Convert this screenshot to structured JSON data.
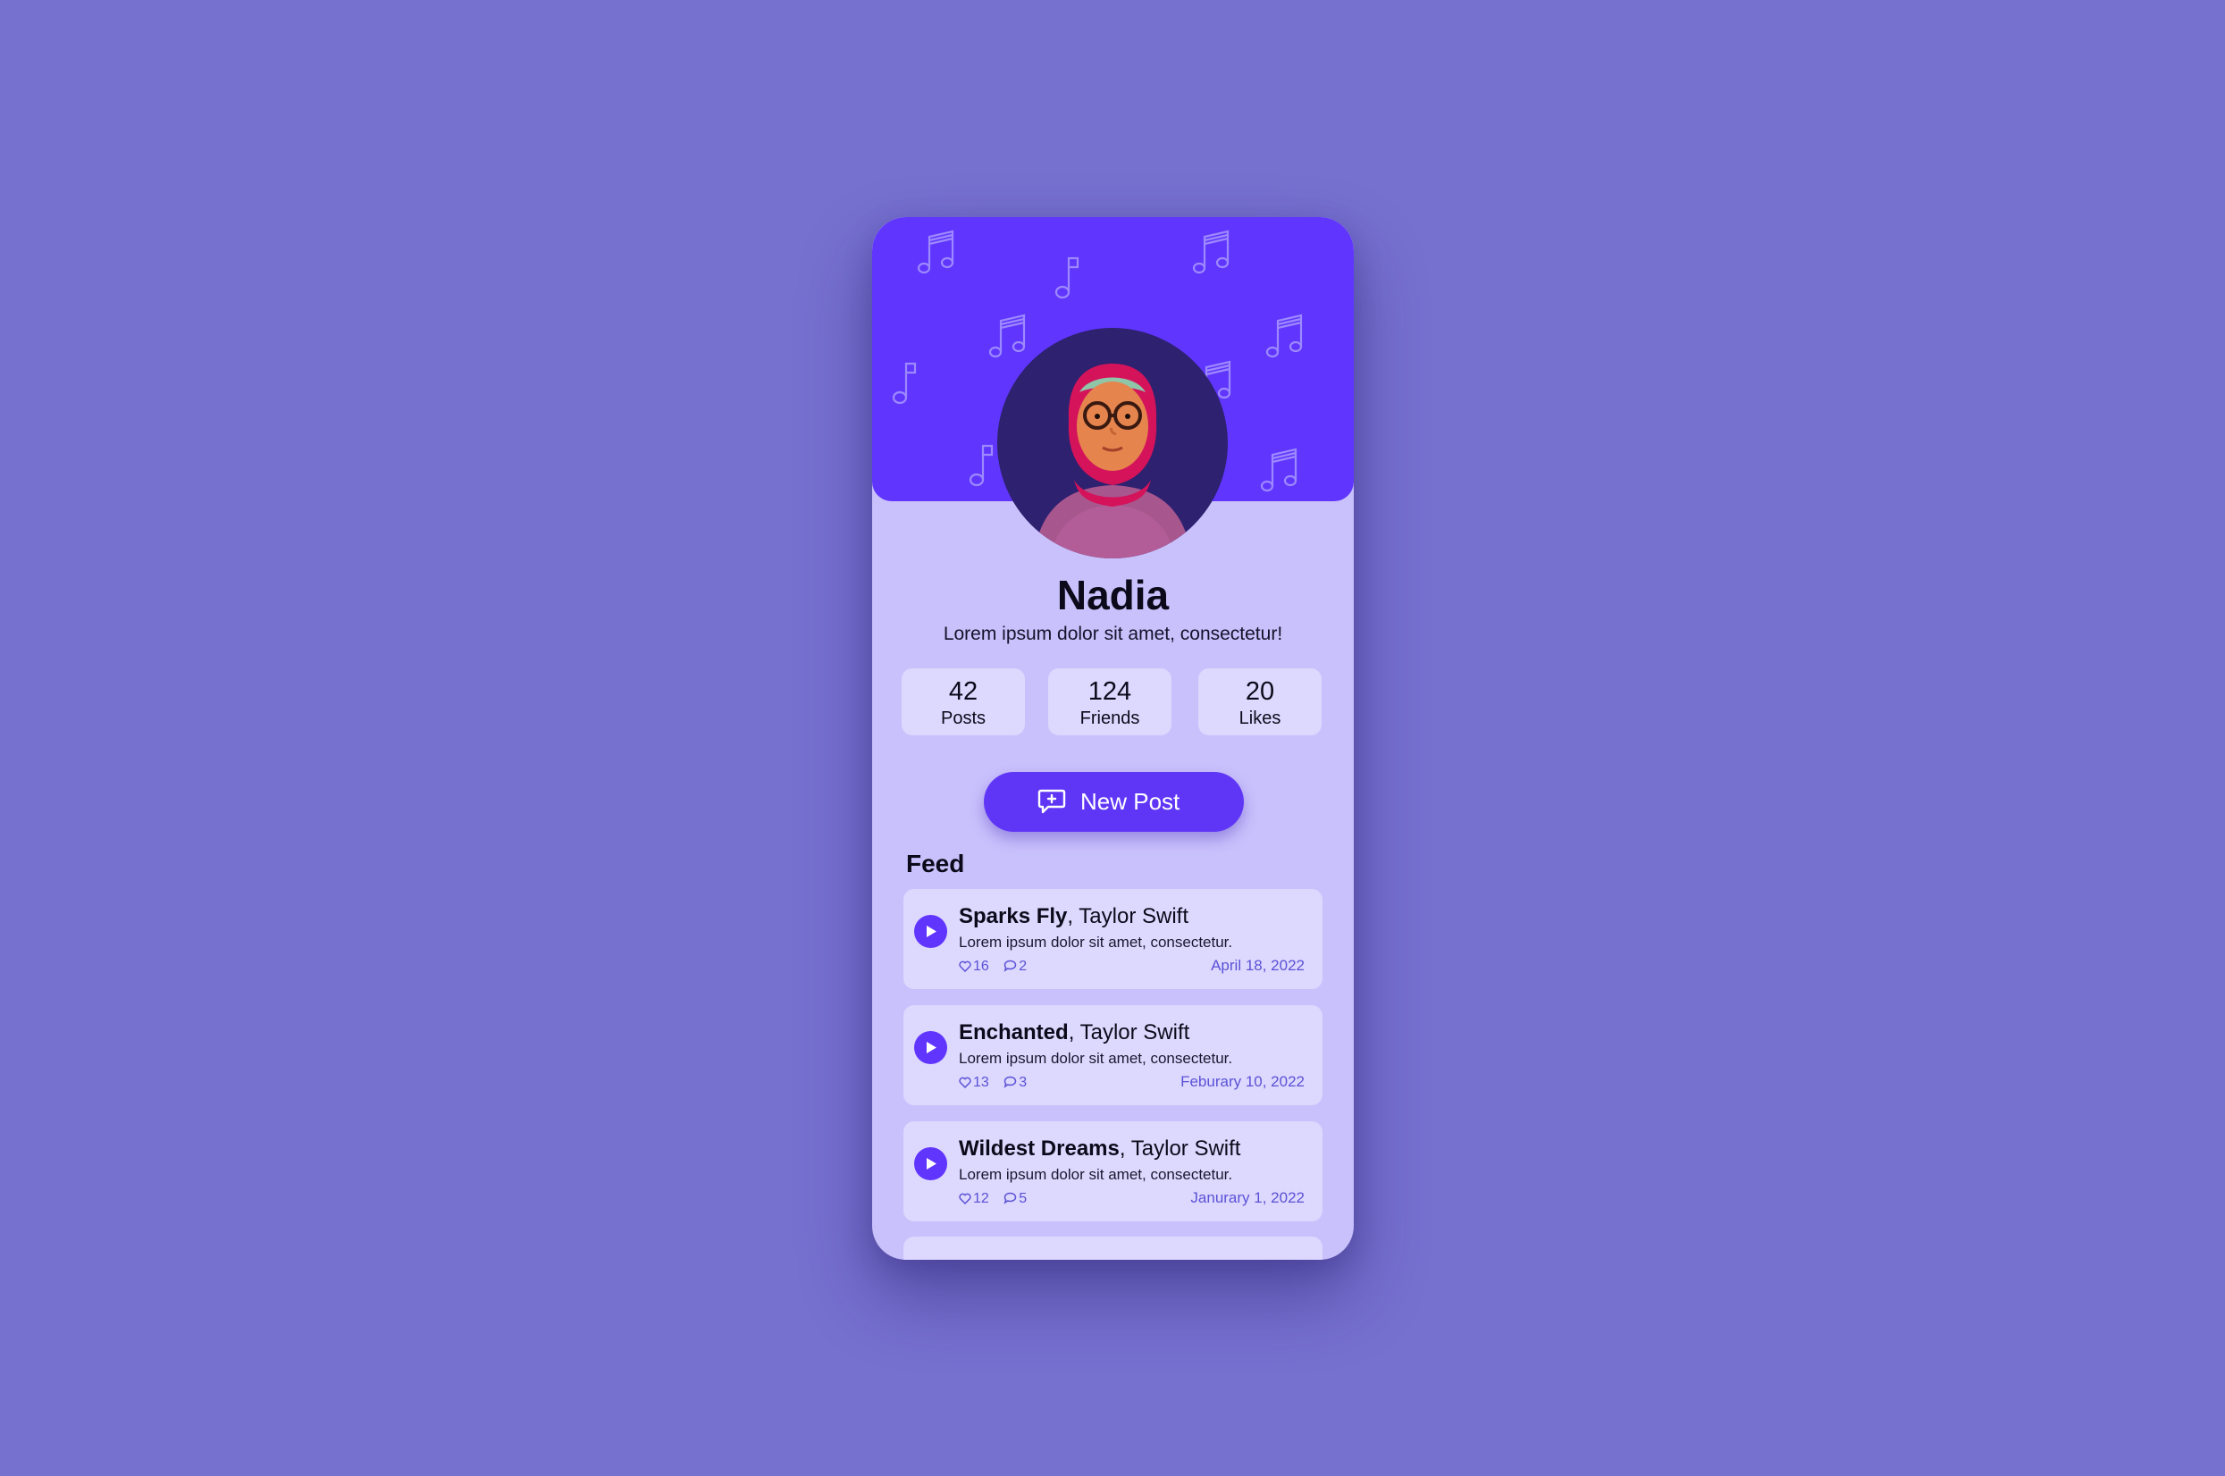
{
  "profile": {
    "name": "Nadia",
    "bio": "Lorem ipsum dolor sit amet, consectetur!"
  },
  "stats": [
    {
      "value": "42",
      "label": "Posts"
    },
    {
      "value": "124",
      "label": "Friends"
    },
    {
      "value": "20",
      "label": "Likes"
    }
  ],
  "actions": {
    "new_post_label": "New Post"
  },
  "feed": {
    "title": "Feed",
    "items": [
      {
        "song": "Sparks Fly",
        "artist": ", Taylor Swift",
        "description": "Lorem ipsum dolor sit amet, consectetur.",
        "likes": "16",
        "comments": "2",
        "date": "April 18, 2022"
      },
      {
        "song": "Enchanted",
        "artist": ", Taylor Swift",
        "description": "Lorem ipsum dolor sit amet, consectetur.",
        "likes": "13",
        "comments": "3",
        "date": "Feburary 10, 2022"
      },
      {
        "song": "Wildest Dreams",
        "artist": ", Taylor Swift",
        "description": "Lorem ipsum dolor sit amet, consectetur.",
        "likes": "12",
        "comments": "5",
        "date": "Janurary 1, 2022"
      }
    ]
  },
  "icons": {
    "header_decoration": "music-note-icon",
    "new_post": "chat-plus-icon",
    "play": "play-icon",
    "like": "heart-icon",
    "comment": "comment-icon"
  },
  "colors": {
    "background": "#7670cf",
    "header": "#6035fe",
    "card": "#ddd8fe",
    "panel": "#c9c1fc",
    "accent_text": "#5a52d6"
  }
}
